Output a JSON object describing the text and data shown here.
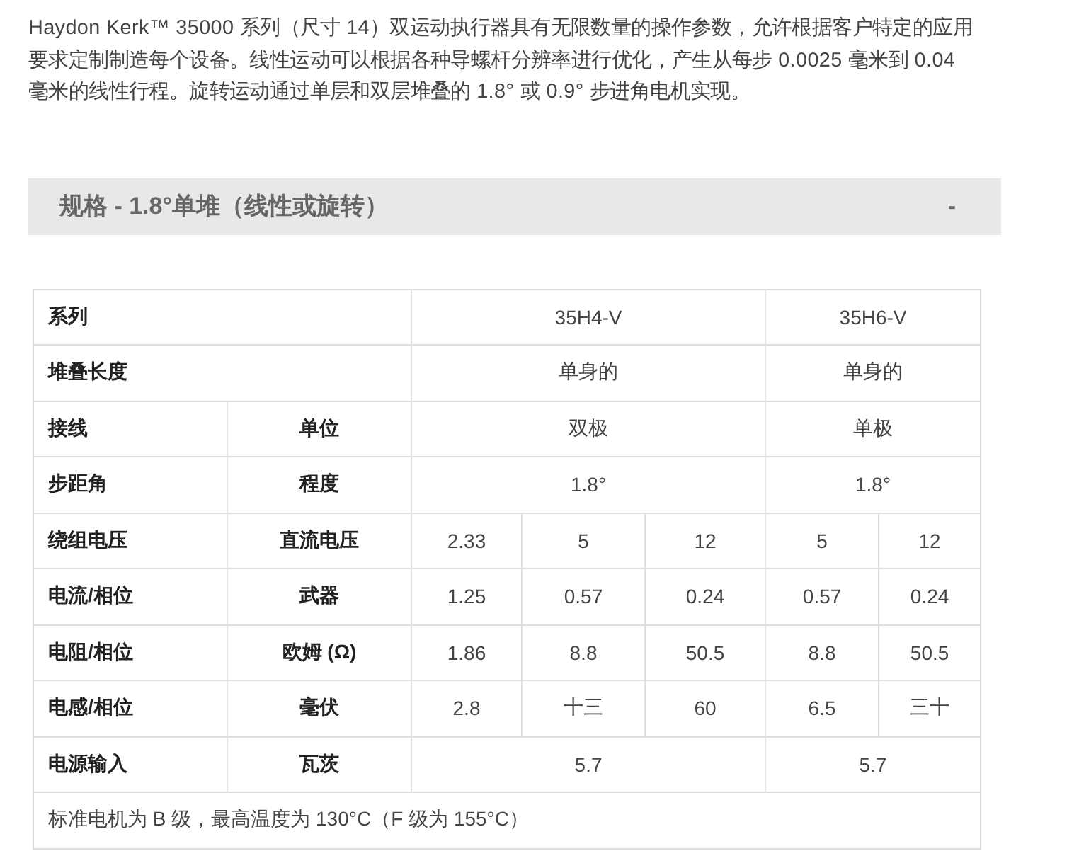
{
  "intro": "Haydon Kerk™ 35000 系列（尺寸 14）双运动执行器具有无限数量的操作参数，允许根据客户特定的应用要求定制制造每个设备。线性运动可以根据各种导螺杆分辨率进行优化，产生从每步 0.0025 毫米到 0.04 毫米的线性行程。旋转运动通过单层和双层堆叠的 1.8° 或 0.9° 步进角电机实现。",
  "section": {
    "title": "规格 - 1.8°单堆（线性或旋转）",
    "toggle": "-"
  },
  "table": {
    "rows": [
      {
        "kind": "wide",
        "label": "系列",
        "values": [
          "35H4-V",
          "35H6-V"
        ]
      },
      {
        "kind": "wide",
        "label": "堆叠长度",
        "values": [
          "单身的",
          "单身的"
        ]
      },
      {
        "kind": "grouped",
        "label": "接线",
        "unit": "单位",
        "values": [
          "双极",
          "单极"
        ]
      },
      {
        "kind": "grouped",
        "label": "步距角",
        "unit": "程度",
        "values": [
          "1.8°",
          "1.8°"
        ]
      },
      {
        "kind": "split",
        "label": "绕组电压",
        "unit": "直流电压",
        "values": [
          "2.33",
          "5",
          "12",
          "5",
          "12"
        ]
      },
      {
        "kind": "split",
        "label": "电流/相位",
        "unit": "武器",
        "values": [
          "1.25",
          "0.57",
          "0.24",
          "0.57",
          "0.24"
        ]
      },
      {
        "kind": "split",
        "label": "电阻/相位",
        "unit": "欧姆 (Ω)",
        "values": [
          "1.86",
          "8.8",
          "50.5",
          "8.8",
          "50.5"
        ]
      },
      {
        "kind": "split",
        "label": "电感/相位",
        "unit": "毫伏",
        "values": [
          "2.8",
          "十三",
          "60",
          "6.5",
          "三十"
        ]
      },
      {
        "kind": "grouped",
        "label": "电源输入",
        "unit": "瓦茨",
        "values": [
          "5.7",
          "5.7"
        ]
      },
      {
        "kind": "note",
        "label": "标准电机为 B 级，最高温度为 130°C（F 级为 155°C）"
      }
    ]
  }
}
